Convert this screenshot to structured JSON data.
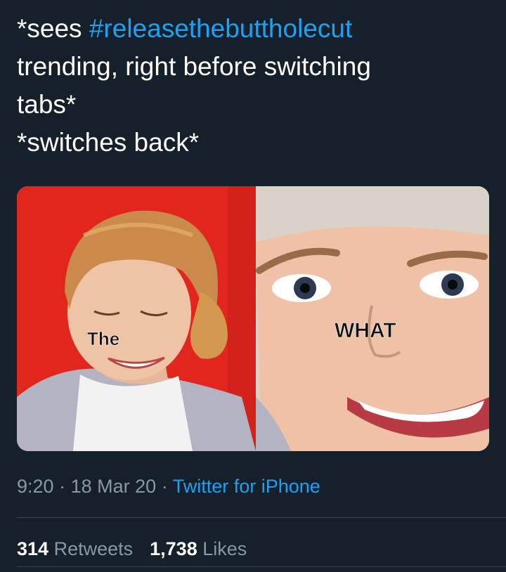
{
  "tweet": {
    "text_line1_prefix": "*sees ",
    "hashtag": "#releasethebuttholecut",
    "text_rest": "\ntrending, right before switching\ntabs*\n*switches back*"
  },
  "media": {
    "left_caption": "The",
    "right_caption": "WHAT",
    "colors": {
      "left_background": "#e0261d",
      "right_background": "#d9d2c8"
    }
  },
  "meta": {
    "time": "9:20",
    "separator": "·",
    "date": "18 Mar 20",
    "source": "Twitter for iPhone"
  },
  "stats": {
    "retweets_count": "314",
    "retweets_label": "Retweets",
    "likes_count": "1,738",
    "likes_label": "Likes"
  },
  "colors": {
    "background": "#15202b",
    "accent": "#1da1f2",
    "muted": "#8899a6",
    "divider": "#38444d"
  }
}
